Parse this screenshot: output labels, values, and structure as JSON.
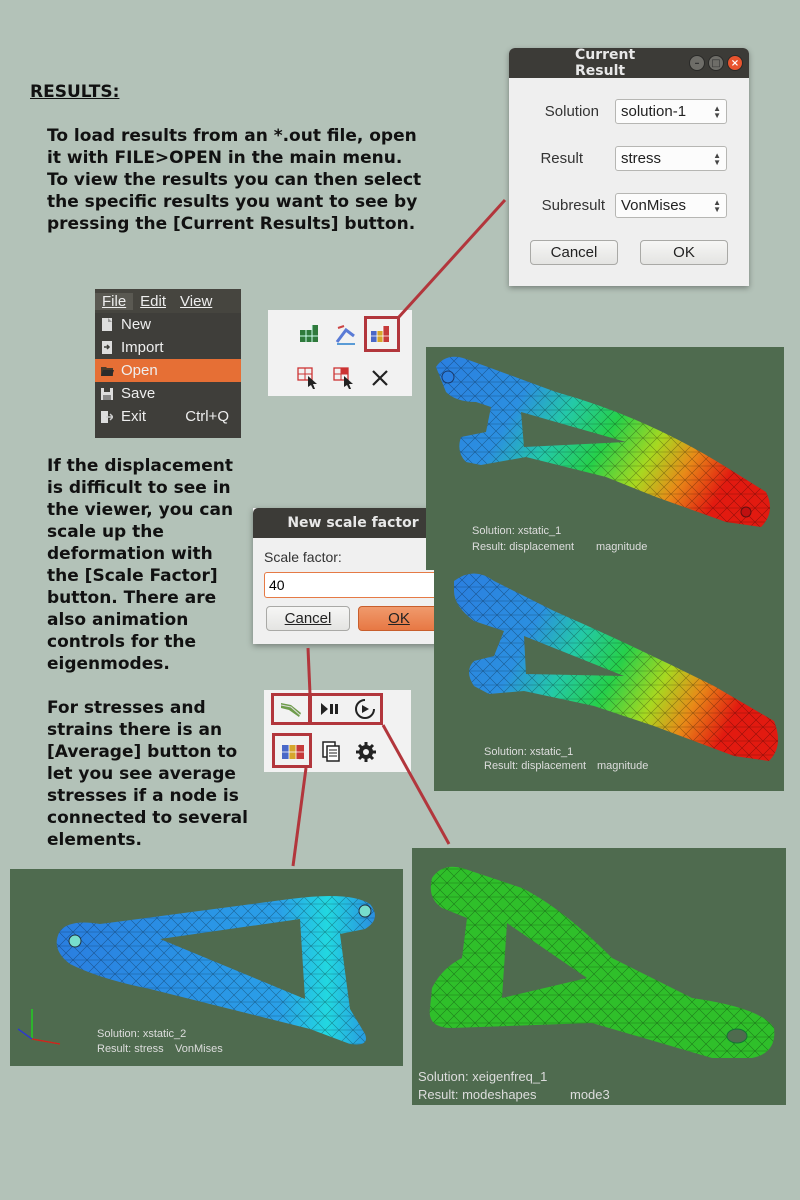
{
  "heading": "RESULTS:",
  "paragraphs": {
    "p1": [
      "To load results from an *.out file, open",
      "it with FILE>OPEN in the main menu.",
      "To view the results you can then select",
      "the specific results you want to see by",
      "pressing the [Current Results] button."
    ],
    "p2": [
      "If the displacement",
      "is difficult to see in",
      "the viewer, you can",
      "scale up the",
      "deformation with",
      "the [Scale Factor]",
      "button. There are",
      "also animation",
      "controls for the",
      "eigenmodes."
    ],
    "p3": [
      "For stresses and",
      "strains there is an",
      "[Average] button to",
      "let you see average",
      "stresses if a node is",
      "connected to several",
      "elements."
    ]
  },
  "current_result": {
    "title": "Current Result",
    "rows": [
      {
        "label": "Solution",
        "value": "solution-1"
      },
      {
        "label": "Result",
        "value": "stress"
      },
      {
        "label": "Subresult",
        "value": "VonMises"
      }
    ],
    "cancel": "Cancel",
    "ok": "OK"
  },
  "menu": {
    "bar": [
      "File",
      "Edit",
      "View"
    ],
    "items": [
      {
        "label": "New",
        "shortcut": "",
        "icon": "new-file-icon"
      },
      {
        "label": "Import",
        "shortcut": "",
        "icon": "import-icon"
      },
      {
        "label": "Open",
        "shortcut": "",
        "icon": "folder-open-icon"
      },
      {
        "label": "Save",
        "shortcut": "",
        "icon": "save-icon"
      },
      {
        "label": "Exit",
        "shortcut": "Ctrl+Q",
        "icon": "exit-icon"
      }
    ]
  },
  "scale_dialog": {
    "title": "New scale factor",
    "label": "Scale factor:",
    "value": "40",
    "cancel": "Cancel",
    "ok": "OK"
  },
  "viewers": [
    {
      "solution": "Solution: xstatic_1",
      "result": "Result: displacement",
      "sub": "magnitude"
    },
    {
      "solution": "Solution: xstatic_1",
      "result": "Result: displacement",
      "sub": "magnitude"
    },
    {
      "solution": "Solution: xstatic_2",
      "result": "Result: stress",
      "sub": "VonMises"
    },
    {
      "solution": "Solution: xeigenfreq_1",
      "result": "Result: modeshapes",
      "sub": "mode3"
    }
  ],
  "colors": {
    "accent_red": "#b2363c",
    "menu_highlight": "#e66f35",
    "viewer_bg": "#4f6b4f",
    "page_bg": "#b3c2b8"
  }
}
